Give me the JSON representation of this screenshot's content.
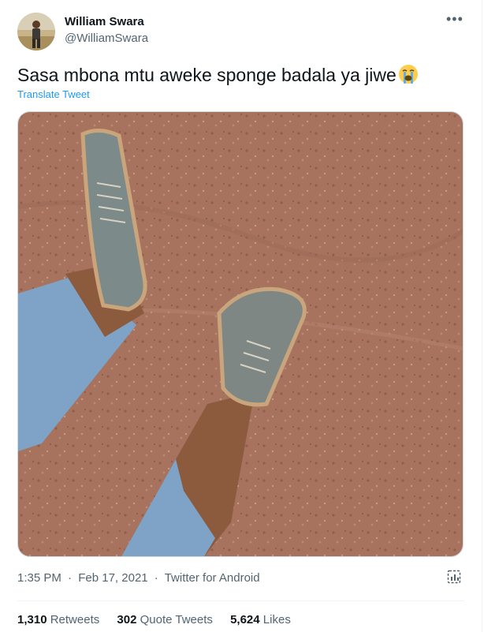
{
  "author": {
    "name": "William Swara",
    "handle": "@WilliamSwara"
  },
  "more_glyph": "•••",
  "tweet": {
    "text": "Sasa mbona mtu aweke sponge badala ya jiwe",
    "emoji": "loudly-crying-face",
    "translate_label": "Translate Tweet"
  },
  "media": {
    "description_icon": "muddy-sneakers-photo"
  },
  "meta": {
    "time": "1:35 PM",
    "dot1": "·",
    "date": "Feb 17, 2021",
    "dot2": "·",
    "source": "Twitter for Android"
  },
  "stats": {
    "retweets_count": "1,310",
    "retweets_label": "Retweets",
    "quotes_count": "302",
    "quotes_label": "Quote Tweets",
    "likes_count": "5,624",
    "likes_label": "Likes"
  },
  "colors": {
    "accent": "#1d9bf0",
    "secondary_text": "#536471",
    "primary_text": "#0f1419"
  }
}
